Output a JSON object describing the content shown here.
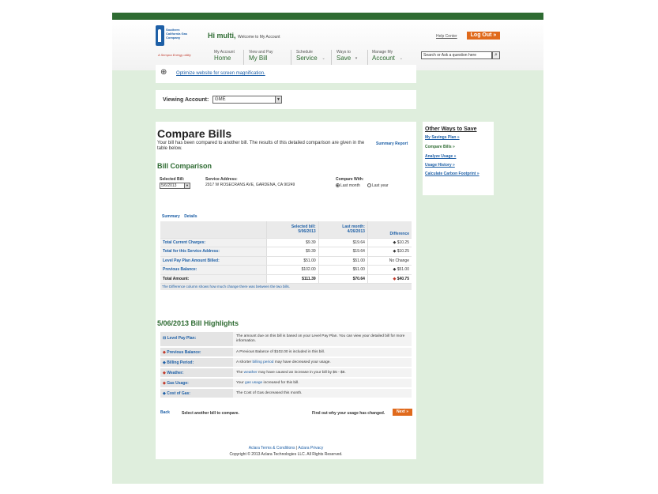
{
  "header": {
    "logo_text": "Southern California Gas Company",
    "logo_sub": "A Sempra Energy utility",
    "greeting": "Hi multi,",
    "greeting_sub": "Welcome to My Account",
    "help": "Help Center",
    "logout": "Log Out »",
    "search_placeholder": "Search or Ask a question here",
    "nav": [
      {
        "small": "My Account",
        "big": "Home"
      },
      {
        "small": "View and Pay",
        "big": "My Bill"
      },
      {
        "small": "Schedule",
        "big": "Service"
      },
      {
        "small": "Ways to",
        "big": "Save"
      },
      {
        "small": "Manage My",
        "big": "Account"
      }
    ]
  },
  "magnify": {
    "link": "Optimize website for screen magnification."
  },
  "viewing": {
    "label": "Viewing Account:",
    "value": "GME"
  },
  "compare": {
    "title": "Compare Bills",
    "intro": "Your bill has been compared to another bill. The results of this detailed comparison are given in the table below.",
    "summary_report": "Summary Report",
    "section": "Bill Comparison",
    "selected_bill_label": "Selected Bill:",
    "selected_bill_value": "5/6/2013",
    "service_address_label": "Service Address:",
    "service_address_value": "2917 W ROSECRANS AVE, GARDENA, CA 90249",
    "compare_with_label": "Compare With:",
    "compare_last_month": "Last month",
    "compare_last_year": "Last year",
    "tab_summary": "Summary",
    "tab_details": "Details",
    "col_selected_1": "Selected bill:",
    "col_selected_2": "5/06/2013",
    "col_last_1": "Last month:",
    "col_last_2": "4/26/2013",
    "col_diff": "Difference",
    "rows": [
      {
        "label": "Total Current Charges:",
        "selected": "$9.39",
        "last": "$19.64",
        "diff": "$10.25",
        "dir": "up"
      },
      {
        "label": "Total for this Service Address:",
        "selected": "$9.39",
        "last": "$19.64",
        "diff": "$10.25",
        "dir": "up"
      },
      {
        "label": "Level Pay Plan Amount Billed:",
        "selected": "$51.00",
        "last": "$51.00",
        "diff": "No Change",
        "dir": "none"
      },
      {
        "label": "Previous Balance:",
        "selected": "$102.00",
        "last": "$51.00",
        "diff": "$51.00",
        "dir": "down"
      },
      {
        "label": "Total Amount:",
        "selected": "$111.39",
        "last": "$70.64",
        "diff": "$40.75",
        "dir": "down"
      }
    ],
    "note": "The Difference column shows how much change there was between the two bills."
  },
  "highlights": {
    "title": "5/06/2013 Bill Highlights",
    "items": [
      {
        "key": "Level Pay Plan:",
        "mark": "⊟",
        "text_pre": "The amount due on this bill is based on your Level Pay Plan. You can view your detailed bill for more information.",
        "link": "",
        "text_post": ""
      },
      {
        "key": "Previous Balance:",
        "mark": "◆",
        "text_pre": "A Previous Balance of $102.00 is included in this bill.",
        "link": "",
        "text_post": ""
      },
      {
        "key": "Billing Period:",
        "mark": "◆",
        "text_pre": "A shorter ",
        "link": "billing period",
        "text_post": " may have decreased your usage."
      },
      {
        "key": "Weather:",
        "mark": "◆",
        "text_pre": "The ",
        "link": "weather",
        "text_post": " may have caused an increase in your bill by $5 - $8."
      },
      {
        "key": "Gas Usage:",
        "mark": "◆",
        "text_pre": "Your ",
        "link": "gas usage",
        "text_post": " increased for this bill."
      },
      {
        "key": "Cost of Gas:",
        "mark": "◆",
        "text_pre": "The Cost of Gas decreased this month.",
        "link": "",
        "text_post": ""
      }
    ]
  },
  "actions": {
    "back": "Back",
    "select_another": "Select another bill to compare.",
    "find_out": "Find out why your usage has changed.",
    "next": "Next »"
  },
  "footer": {
    "terms": "Aclara Terms & Conditions",
    "sep": "|",
    "privacy": "Aclara Privacy",
    "copyright": "Copyright © 2013 Aclara Technologies LLC. All Rights Reserved."
  },
  "sidebar": {
    "title": "Other Ways to Save",
    "links": [
      "My Savings Plan »",
      "Compare Bills »",
      "Analyze Usage »",
      "Usage History »",
      "Calculate Carbon Footprint »"
    ]
  },
  "colors": {
    "brand_green": "#2e6b32",
    "link_blue": "#1d5fa6",
    "accent_orange": "#e06a1c",
    "up_blue": "#1d5fa6",
    "down_red": "#c0392b"
  }
}
